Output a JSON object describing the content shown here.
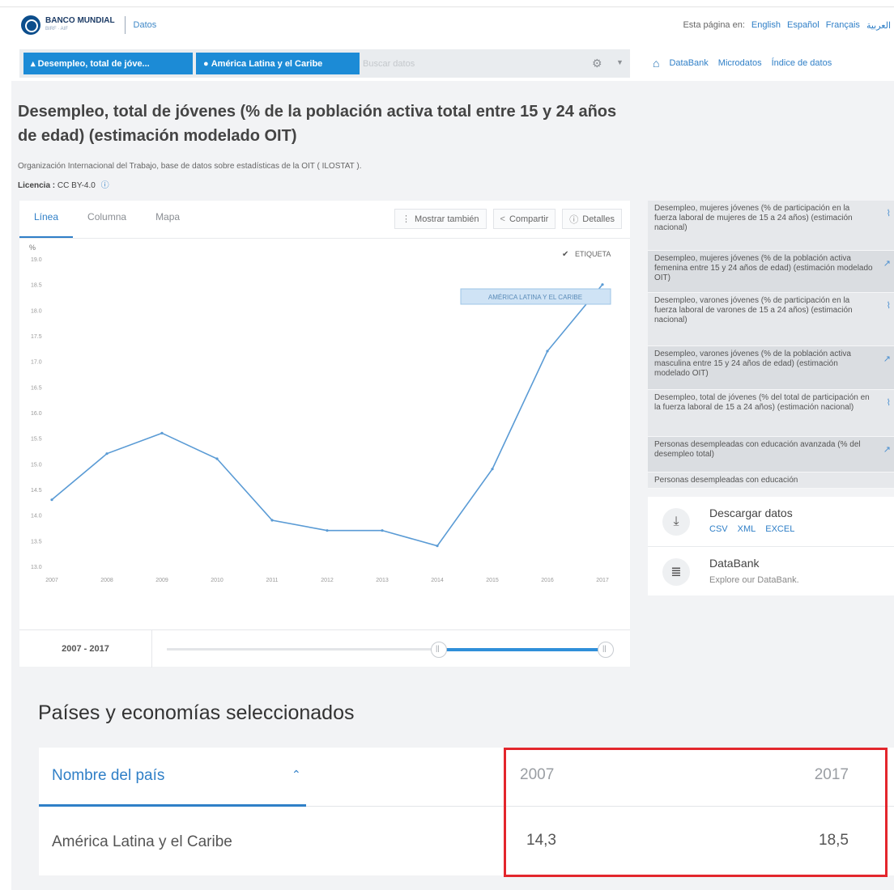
{
  "header": {
    "brand_name": "BANCO MUNDIAL",
    "brand_sub": "BIRF · AIF",
    "section": "Datos",
    "language_prompt": "Esta página en:",
    "languages": [
      "English",
      "Español",
      "Français",
      "العربية"
    ]
  },
  "search": {
    "indicator_chip": "Desempleo, total de jóve...",
    "region_chip": "América Latina y el Caribe",
    "placeholder": "Buscar datos"
  },
  "nav": {
    "links": [
      "DataBank",
      "Microdatos",
      "Índice de datos"
    ]
  },
  "page": {
    "title": "Desempleo, total de jóvenes (% de la población activa total entre 15 y 24 años de edad) (estimación modelado OIT)",
    "source": "Organización Internacional del Trabajo, base de datos sobre estadísticas de la OIT ( ILOSTAT ).",
    "license_label": "Licencia :",
    "license_value": "CC BY-4.0"
  },
  "chart_card": {
    "tabs": [
      "Línea",
      "Columna",
      "Mapa"
    ],
    "active_tab": "Línea",
    "toolbar": [
      "Mostrar también",
      "Compartir",
      "Detalles"
    ],
    "labels_checkbox": "ETIQUETA",
    "range_label": "2007 - 2017"
  },
  "chart_data": {
    "type": "line",
    "ylabel": "%",
    "x": [
      2007,
      2008,
      2009,
      2010,
      2011,
      2012,
      2013,
      2014,
      2015,
      2016,
      2017
    ],
    "series": [
      {
        "name": "AMÉRICA LATINA Y EL CARIBE",
        "values": [
          14.3,
          15.2,
          15.6,
          15.1,
          13.9,
          13.7,
          13.7,
          13.4,
          14.9,
          17.2,
          18.5
        ]
      }
    ],
    "y_ticks": [
      "13.0",
      "13.5",
      "14.0",
      "14.5",
      "15.0",
      "15.5",
      "16.0",
      "16.5",
      "17.0",
      "17.5",
      "18.0",
      "18.5",
      "19.0"
    ],
    "ylim": [
      13.0,
      19.0
    ],
    "grid": false,
    "color": "#5a9bd5"
  },
  "related": [
    "Desempleo, mujeres jóvenes (% de participación en la fuerza laboral de mujeres de 15 a 24 años) (estimación nacional)",
    "Desempleo, mujeres jóvenes (% de la población activa femenina entre 15 y 24 años de edad) (estimación modelado OIT)",
    "Desempleo, varones jóvenes (% de participación en la fuerza laboral de varones de 15 a 24 años) (estimación nacional)",
    "Desempleo, varones jóvenes (% de la población activa masculina entre 15 y 24 años de edad) (estimación modelado OIT)",
    "Desempleo, total de jóvenes (% del total de participación en la fuerza laboral de 15 a 24 años) (estimación nacional)",
    "Personas desempleadas con educación avanzada (% del desempleo total)",
    "Personas desempleadas con educación"
  ],
  "download": {
    "title": "Descargar datos",
    "formats": [
      "CSV",
      "XML",
      "EXCEL"
    ],
    "databank_title": "DataBank",
    "databank_sub": "Explore our DataBank."
  },
  "table": {
    "section_title": "Países y economías seleccionados",
    "col_name": "Nombre del país",
    "col_start": "2007",
    "col_end": "2017",
    "rows": [
      {
        "name": "América Latina y el Caribe",
        "start": "14,3",
        "end": "18,5"
      }
    ]
  },
  "colors": {
    "accent": "#2f7fc7",
    "chip": "#1c8bd6",
    "highlight": "#e3262c"
  }
}
